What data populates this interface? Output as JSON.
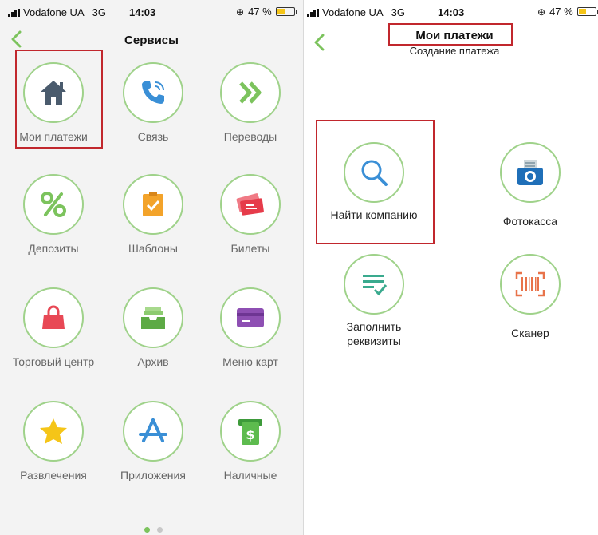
{
  "colors": {
    "accent_green": "#7cc35d",
    "circle_border": "#9fd28a",
    "highlight": "#c1272d"
  },
  "status_bar": {
    "carrier": "Vodafone UA",
    "network": "3G",
    "time": "14:03",
    "battery": "47 %",
    "battery_level_fraction": 0.47
  },
  "services_screen": {
    "title": "Сервисы",
    "tiles": [
      {
        "label": "Мои платежи",
        "icon": "home-icon"
      },
      {
        "label": "Связь",
        "icon": "phone-icon"
      },
      {
        "label": "Переводы",
        "icon": "double-chevron-icon"
      },
      {
        "label": "Депозиты",
        "icon": "percent-icon"
      },
      {
        "label": "Шаблоны",
        "icon": "clipboard-check-icon"
      },
      {
        "label": "Билеты",
        "icon": "tickets-icon"
      },
      {
        "label": "Торговый центр",
        "icon": "shopping-bag-icon"
      },
      {
        "label": "Архив",
        "icon": "archive-tray-icon"
      },
      {
        "label": "Меню карт",
        "icon": "card-icon"
      },
      {
        "label": "Развлечения",
        "icon": "star-icon"
      },
      {
        "label": "Приложения",
        "icon": "app-store-icon"
      },
      {
        "label": "Наличные",
        "icon": "cash-icon"
      }
    ],
    "pagination": {
      "pages": 2,
      "current": 1
    }
  },
  "payments_screen": {
    "title": "Мои платежи",
    "subtitle": "Создание платежа",
    "tiles": [
      {
        "label": "Найти компанию",
        "icon": "search-icon"
      },
      {
        "label": "Фотокасса",
        "icon": "camera-icon"
      },
      {
        "label": "Заполнить реквизиты",
        "icon": "form-check-icon"
      },
      {
        "label": "Сканер",
        "icon": "barcode-scanner-icon"
      }
    ]
  }
}
